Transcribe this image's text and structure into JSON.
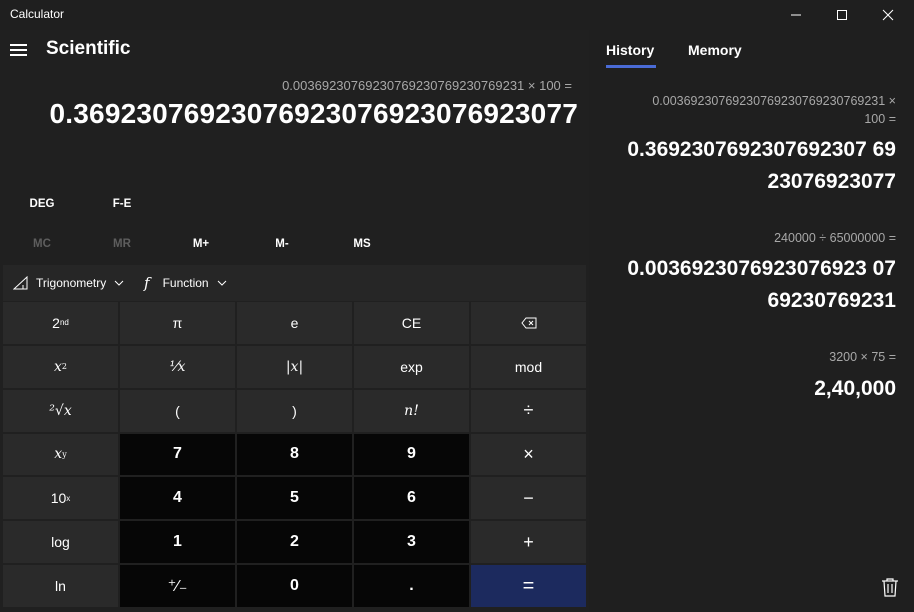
{
  "window": {
    "title": "Calculator"
  },
  "header": {
    "mode_title": "Scientific"
  },
  "display": {
    "expression": "0.00369230769230769230769230769231 × 100 =",
    "result": "0.36923076923076923076923076923077"
  },
  "angle_row": {
    "deg_label": "DEG",
    "fe_label": "F-E"
  },
  "memory_row": {
    "mc": "MC",
    "mr": "MR",
    "mplus": "M+",
    "mminus": "M-",
    "ms": "MS",
    "disabled": [
      "MC",
      "MR"
    ]
  },
  "function_bar": {
    "trig_label": "Trigonometry",
    "func_label": "Function"
  },
  "keypad": {
    "second": "2",
    "second_sup": "nd",
    "pi": "π",
    "e": "e",
    "ce": "CE",
    "x": "x",
    "sq_sup": "2",
    "reciprocal": "⅟x",
    "abs": "|x|",
    "exp": "exp",
    "mod": "mod",
    "root": "²√x",
    "lparen": "(",
    "rparen": ")",
    "factorial": "n!",
    "divide": "÷",
    "pow_sup": "y",
    "n7": "7",
    "n8": "8",
    "n9": "9",
    "multiply": "×",
    "ten": "10",
    "ten_sup": "x",
    "n4": "4",
    "n5": "5",
    "n6": "6",
    "minus": "−",
    "log": "log",
    "n1": "1",
    "n2": "2",
    "n3": "3",
    "plus": "+",
    "ln": "ln",
    "negate": "⁺∕₋",
    "n0": "0",
    "decimal": ".",
    "equals": "="
  },
  "history_panel": {
    "tab_history": "History",
    "tab_memory": "Memory",
    "entries": [
      {
        "expr_line1": "0.00369230769230769230769230769231   ×",
        "expr_line2": "100 =",
        "res_line1": "0.3692307692307692307 69",
        "res_line2": "23076923077"
      },
      {
        "expr_line1": "240000   ÷   65000000 =",
        "res_line1": "0.0036923076923076923 07",
        "res_line2": "69230769231"
      },
      {
        "expr_line1": "3200   ×   75 =",
        "res_line1": "2,40,000"
      }
    ]
  },
  "colors": {
    "background": "#202020",
    "key_function": "#2a2a2a",
    "key_number": "#060606",
    "key_equals": "#1c2a5e",
    "accent": "#4a6bd6"
  }
}
